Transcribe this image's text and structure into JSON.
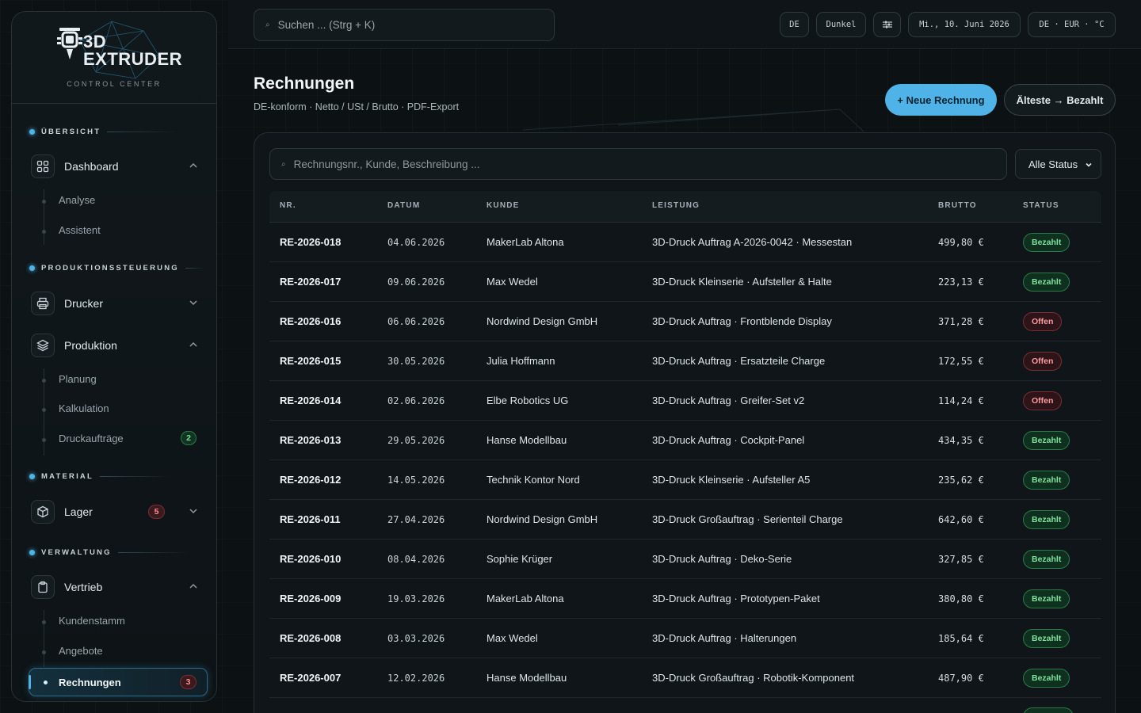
{
  "logo": {
    "line1": "3D",
    "line2": "EXTRUDER",
    "subtitle": "CONTROL CENTER"
  },
  "sidebar": {
    "sections": [
      "ÜBERSICHT",
      "PRODUKTIONSSTEUERUNG",
      "MATERIAL",
      "VERWALTUNG"
    ],
    "dashboard": {
      "label": "Dashboard",
      "icon": "grid-icon",
      "children": [
        "Analyse",
        "Assistent"
      ]
    },
    "drucker": {
      "label": "Drucker",
      "icon": "printer-icon"
    },
    "produktion": {
      "label": "Produktion",
      "icon": "layers-icon",
      "children": [
        "Planung",
        "Kalkulation",
        "Druckaufträge"
      ],
      "druckauftraege_badge": "2"
    },
    "lager": {
      "label": "Lager",
      "icon": "box-icon",
      "badge": "5"
    },
    "vertrieb": {
      "label": "Vertrieb",
      "icon": "clipboard-icon",
      "children": [
        "Kundenstamm",
        "Angebote",
        "Rechnungen"
      ],
      "rechnungen_badge": "3"
    }
  },
  "topbar": {
    "search_placeholder": "Suchen ... (Strg + K)",
    "lang": "DE",
    "theme": "Dunkel",
    "date": "Mi., 10. Juni 2026",
    "locale": "DE · EUR · °C"
  },
  "page": {
    "title": "Rechnungen",
    "subtitle": "DE-konform · Netto / USt / Brutto · PDF-Export",
    "new_button": "+ Neue Rechnung",
    "sort_button": "Älteste → Bezahlt",
    "search_placeholder": "Rechnungsnr., Kunde, Beschreibung ...",
    "status_filter": "Alle Status"
  },
  "table": {
    "columns": [
      "NR.",
      "DATUM",
      "KUNDE",
      "LEISTUNG",
      "BRUTTO",
      "STATUS"
    ],
    "rows": [
      {
        "nr": "RE-2026-018",
        "datum": "04.06.2026",
        "kunde": "MakerLab Altona",
        "leistung": "3D-Druck Auftrag A-2026-0042 · Messestan",
        "brutto": "499,80 €",
        "status": "Bezahlt"
      },
      {
        "nr": "RE-2026-017",
        "datum": "09.06.2026",
        "kunde": "Max Wedel",
        "leistung": "3D-Druck Kleinserie · Aufsteller & Halte",
        "brutto": "223,13 €",
        "status": "Bezahlt"
      },
      {
        "nr": "RE-2026-016",
        "datum": "06.06.2026",
        "kunde": "Nordwind Design GmbH",
        "leistung": "3D-Druck Auftrag · Frontblende Display",
        "brutto": "371,28 €",
        "status": "Offen"
      },
      {
        "nr": "RE-2026-015",
        "datum": "30.05.2026",
        "kunde": "Julia Hoffmann",
        "leistung": "3D-Druck Auftrag · Ersatzteile Charge",
        "brutto": "172,55 €",
        "status": "Offen"
      },
      {
        "nr": "RE-2026-014",
        "datum": "02.06.2026",
        "kunde": "Elbe Robotics UG",
        "leistung": "3D-Druck Auftrag · Greifer-Set v2",
        "brutto": "114,24 €",
        "status": "Offen"
      },
      {
        "nr": "RE-2026-013",
        "datum": "29.05.2026",
        "kunde": "Hanse Modellbau",
        "leistung": "3D-Druck Auftrag · Cockpit-Panel",
        "brutto": "434,35 €",
        "status": "Bezahlt"
      },
      {
        "nr": "RE-2026-012",
        "datum": "14.05.2026",
        "kunde": "Technik Kontor Nord",
        "leistung": "3D-Druck Kleinserie · Aufsteller A5",
        "brutto": "235,62 €",
        "status": "Bezahlt"
      },
      {
        "nr": "RE-2026-011",
        "datum": "27.04.2026",
        "kunde": "Nordwind Design GmbH",
        "leistung": "3D-Druck Großauftrag · Serienteil Charge",
        "brutto": "642,60 €",
        "status": "Bezahlt"
      },
      {
        "nr": "RE-2026-010",
        "datum": "08.04.2026",
        "kunde": "Sophie Krüger",
        "leistung": "3D-Druck Auftrag · Deko-Serie",
        "brutto": "327,85 €",
        "status": "Bezahlt"
      },
      {
        "nr": "RE-2026-009",
        "datum": "19.03.2026",
        "kunde": "MakerLab Altona",
        "leistung": "3D-Druck Auftrag · Prototypen-Paket",
        "brutto": "380,80 €",
        "status": "Bezahlt"
      },
      {
        "nr": "RE-2026-008",
        "datum": "03.03.2026",
        "kunde": "Max Wedel",
        "leistung": "3D-Druck Auftrag · Halterungen",
        "brutto": "185,64 €",
        "status": "Bezahlt"
      },
      {
        "nr": "RE-2026-007",
        "datum": "12.02.2026",
        "kunde": "Hanse Modellbau",
        "leistung": "3D-Druck Großauftrag · Robotik-Komponent",
        "brutto": "487,90 €",
        "status": "Bezahlt"
      }
    ]
  },
  "colors": {
    "accent": "#4fb3e8",
    "paid": "#7ee39b",
    "open": "#ff9aa2",
    "background": "#0c1114"
  }
}
